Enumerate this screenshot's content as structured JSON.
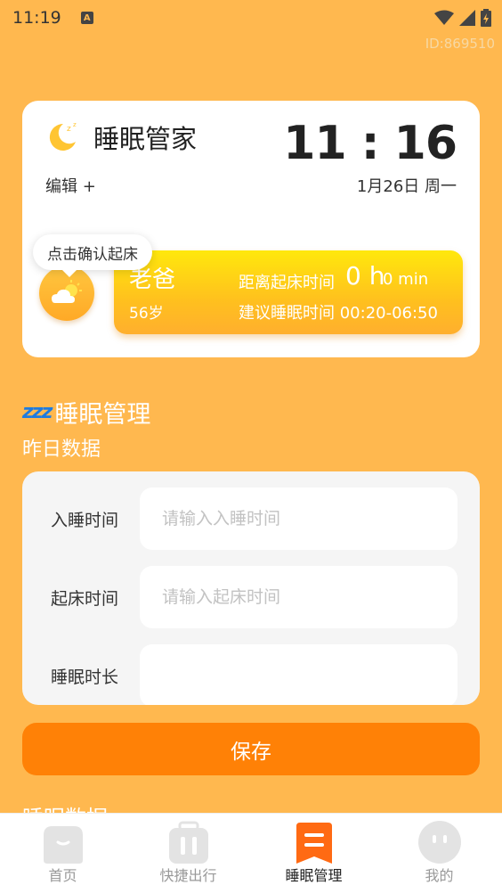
{
  "status_bar": {
    "time": "11:19",
    "notification_icon": "a-icon",
    "icons": [
      "wifi-icon",
      "signal-icon",
      "battery-icon"
    ],
    "device_id": "ID:869510"
  },
  "header_card": {
    "app_name": "睡眠管家",
    "clock": "11 : 16",
    "edit_label": "编辑 +",
    "date": "1月26日 周一",
    "tooltip": "点击确认起床",
    "member": {
      "name": "老爸",
      "age": "56岁",
      "wake_label": "距离起床时间",
      "wake_hours": "0 h",
      "wake_minutes": "0 min",
      "suggest": "建议睡眠时间 00:20-06:50"
    }
  },
  "section": {
    "title": "睡眠管理",
    "subtitle": "昨日数据"
  },
  "form": {
    "sleep_time": {
      "label": "入睡时间",
      "placeholder": "请输入入睡时间",
      "value": ""
    },
    "wake_time": {
      "label": "起床时间",
      "placeholder": "请输入起床时间",
      "value": ""
    },
    "duration": {
      "label": "睡眠时长",
      "placeholder": "",
      "value": ""
    }
  },
  "save_label": "保存",
  "next_section_peek": "睡眠数据",
  "tabs": [
    {
      "label": "首页",
      "icon": "home-icon",
      "active": false
    },
    {
      "label": "快捷出行",
      "icon": "luggage-icon",
      "active": false
    },
    {
      "label": "睡眠管理",
      "icon": "sleep-menu-icon",
      "active": true
    },
    {
      "label": "我的",
      "icon": "profile-face-icon",
      "active": false
    }
  ],
  "colors": {
    "background": "#FFB84F",
    "accent": "#FF8106",
    "banner_top": "#FFE80C",
    "banner_bottom": "#FFAF2E",
    "active_tab": "#FF6A13"
  }
}
